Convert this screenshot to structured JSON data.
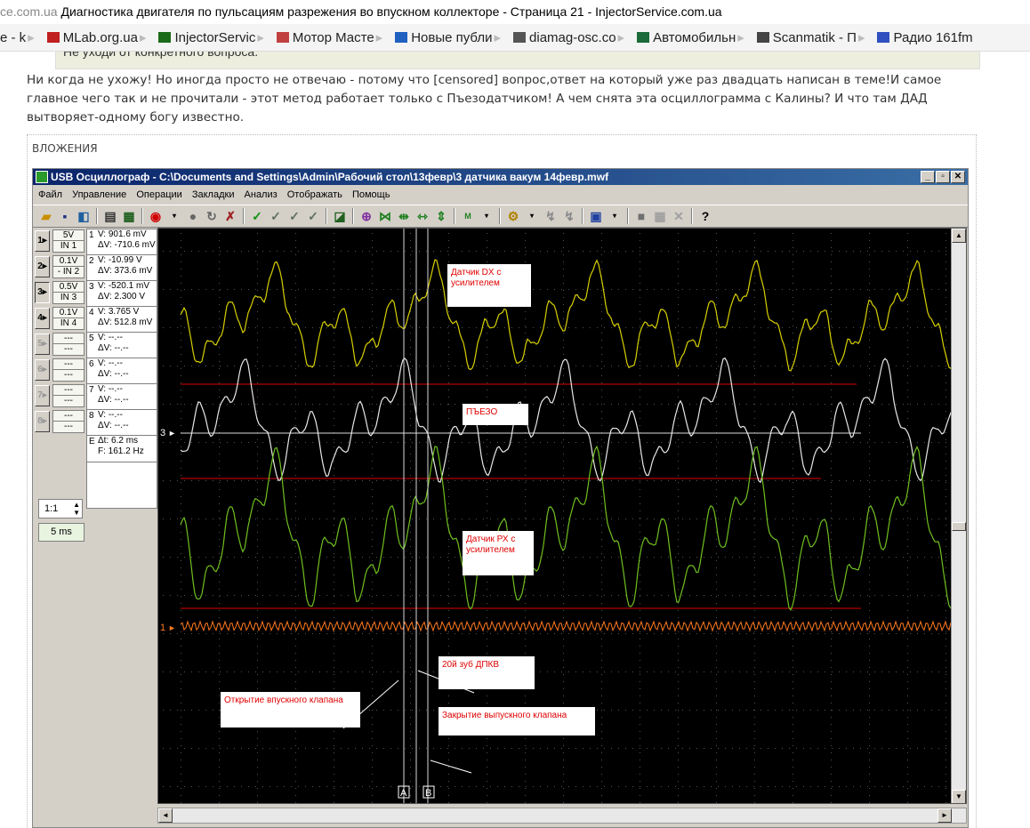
{
  "browser": {
    "title_url": "ce.com.ua",
    "title_text": "Диагностика двигателя по пульсациям разрежения во впускном коллекторе - Страница 21 - InjectorService.com.ua",
    "bookmarks": [
      {
        "label": "e - k",
        "icon": "bookmark-icon",
        "color": "#888888"
      },
      {
        "label": "MLab.org.ua",
        "icon": "car-icon",
        "color": "#c02020"
      },
      {
        "label": "InjectorServic",
        "icon": "site-icon",
        "color": "#1a6a1a"
      },
      {
        "label": "Мотор Масте",
        "icon": "site-icon",
        "color": "#c04040"
      },
      {
        "label": "Новые публи",
        "icon": "site-icon",
        "color": "#2060c0"
      },
      {
        "label": "diamag-osc.co",
        "icon": "page-icon",
        "color": "#555555"
      },
      {
        "label": "Автомобильн",
        "icon": "site-icon",
        "color": "#1a6a3a"
      },
      {
        "label": "Scanmatik - П",
        "icon": "site-icon",
        "color": "#444444"
      },
      {
        "label": "Радио 161fm",
        "icon": "radio-icon",
        "color": "#3050c0"
      }
    ]
  },
  "forum": {
    "quote_text": "Не уходи от конкретного вопроса.",
    "post_text": "Ни когда не ухожу! Но иногда просто не отвечаю - потому что [censored] вопрос,ответ на который уже раз двадцать написан в теме!И самое главное чего так и не прочитали - этот метод работает только с Пъезодатчиком! А чем снята эта осциллограмма с Калины? И что там ДАД вытворяет-одному богу известно.",
    "attachments_label": "ВЛОЖЕНИЯ"
  },
  "app": {
    "title": "USB Осциллограф - C:\\Documents and Settings\\Admin\\Рабочий стол\\13февр\\3 датчика вакум 14февр.mwf",
    "window_buttons": [
      "_",
      "▫",
      "✕"
    ],
    "menu": [
      "Файл",
      "Управление",
      "Операции",
      "Закладки",
      "Анализ",
      "Отображать",
      "Помощь"
    ],
    "channels": [
      {
        "num": "1",
        "scale": "5V",
        "input": "IN 1",
        "v": "V: 901.6 mV",
        "dv": "ΔV: -710.6 mV",
        "active": false,
        "enabled": true
      },
      {
        "num": "2",
        "scale": "0.1V",
        "input": "- IN 2",
        "v": "V: -10.99 V",
        "dv": "ΔV: 373.6 mV",
        "active": false,
        "enabled": true
      },
      {
        "num": "3",
        "scale": "0.5V",
        "input": "IN 3",
        "v": "V: -520.1 mV",
        "dv": "ΔV: 2.300 V",
        "active": true,
        "enabled": true
      },
      {
        "num": "4",
        "scale": "0.1V",
        "input": "IN 4",
        "v": "V: 3.765 V",
        "dv": "ΔV: 512.8 mV",
        "active": false,
        "enabled": true
      },
      {
        "num": "5",
        "scale": "---",
        "input": "---",
        "v": "V: --.--",
        "dv": "ΔV: --.--",
        "active": false,
        "enabled": false
      },
      {
        "num": "6",
        "scale": "---",
        "input": "---",
        "v": "V: --.--",
        "dv": "ΔV: --.--",
        "active": false,
        "enabled": false
      },
      {
        "num": "7",
        "scale": "---",
        "input": "---",
        "v": "V: --.--",
        "dv": "ΔV: --.--",
        "active": false,
        "enabled": false
      },
      {
        "num": "8",
        "scale": "---",
        "input": "---",
        "v": "V: --.--",
        "dv": "ΔV: --.--",
        "active": false,
        "enabled": false
      }
    ],
    "zoom": "1:1",
    "timebase": "5 ms",
    "dt": "Δt: 6.2 ms",
    "freq": "F: 161.2 Hz",
    "marker_a": "A",
    "marker_b": "B",
    "ch3_marker": "3",
    "ch1_marker": "1",
    "annotations": {
      "dx": "Датчик DX с усилителем",
      "piezo": "ПЪЕЗО",
      "px": "Датчик РХ с усилителем",
      "tooth": "20й зуб  ДПКВ",
      "intake": "Открытие впускного клапана",
      "exhaust": "Закрытие выпускного клапана"
    },
    "colors": {
      "yellow_trace": "#d8d000",
      "white_trace": "#e8e8e8",
      "green_trace": "#70c020",
      "orange_trace": "#ff7a20",
      "ref_lines": "#e00000"
    }
  }
}
